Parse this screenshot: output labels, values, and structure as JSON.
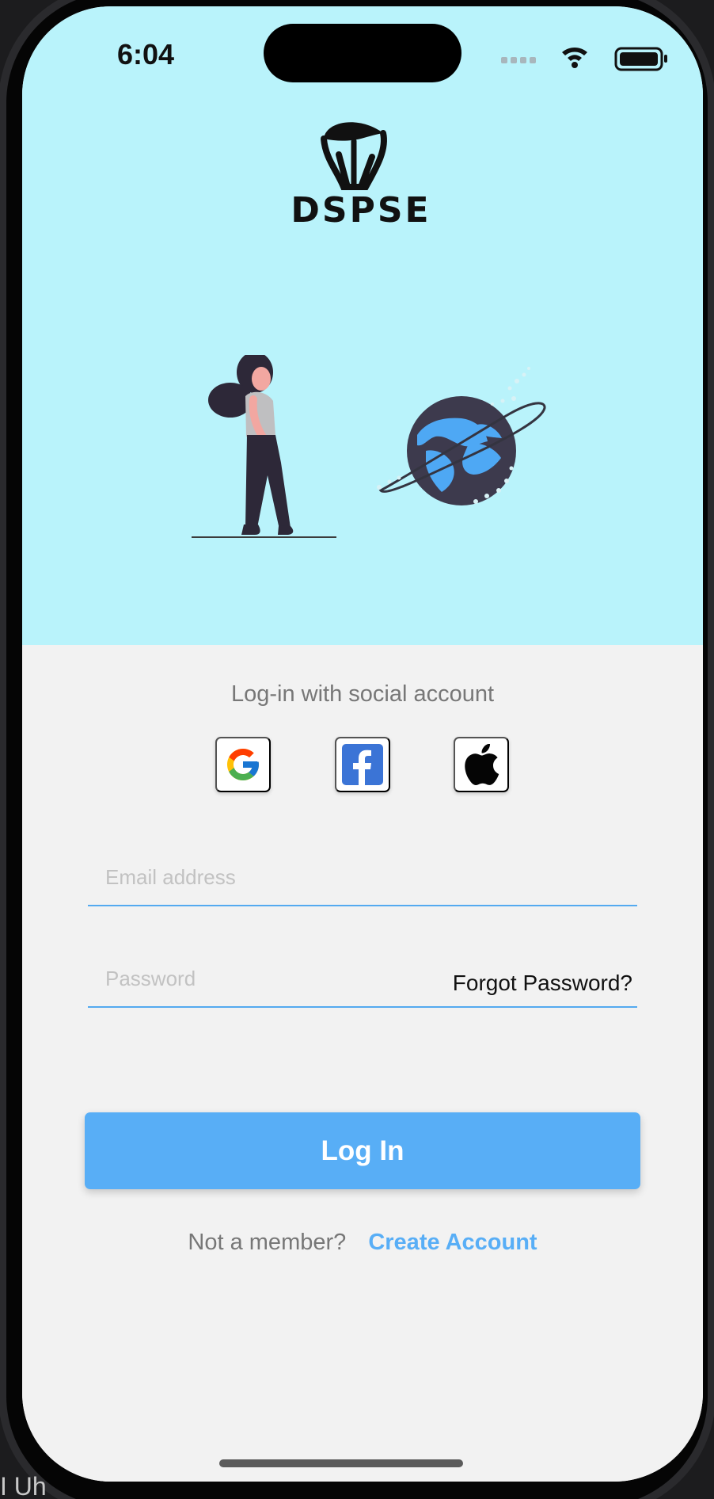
{
  "status_bar": {
    "time": "6:04",
    "icons": [
      "signal-icon",
      "wifi-icon",
      "battery-icon"
    ]
  },
  "brand": {
    "logo_text": "DSPSE",
    "hero_background": "#b9f3fb"
  },
  "login": {
    "social_heading": "Log-in with social account",
    "social_buttons": [
      "google-icon",
      "facebook-icon",
      "apple-icon"
    ],
    "email": {
      "value": "",
      "placeholder": "Email address"
    },
    "password": {
      "value": "",
      "placeholder": "Password"
    },
    "forgot_password_label": "Forgot Password?",
    "login_button_label": "Log In",
    "signup_prompt": "Not a member?",
    "signup_link_label": "Create Account"
  },
  "colors": {
    "accent": "#58aef6",
    "text_muted": "#777777",
    "screen_background": "#f2f2f2"
  },
  "background_text": "I Uh"
}
